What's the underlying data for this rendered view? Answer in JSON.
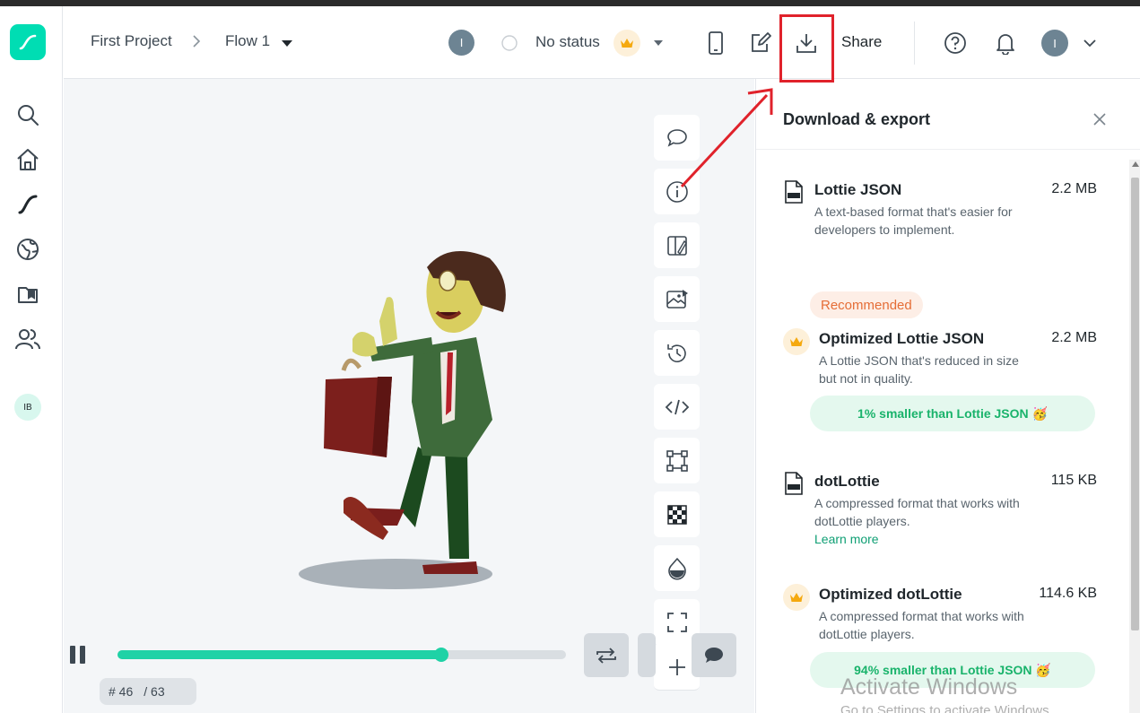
{
  "header": {
    "project": "First Project",
    "flow": "Flow 1",
    "user_initial": "I",
    "status": "No status",
    "share_label": "Share",
    "profile_initial": "I"
  },
  "sidebar": {
    "items": [
      {
        "icon": "search-icon"
      },
      {
        "icon": "home-icon"
      },
      {
        "icon": "lottie-logo-icon"
      },
      {
        "icon": "globe-icon"
      },
      {
        "icon": "library-icon"
      },
      {
        "icon": "team-icon"
      }
    ],
    "workspace_initials": "IB"
  },
  "canvas": {
    "tools": [
      "comment-icon",
      "info-icon",
      "theme-icon",
      "image-icon",
      "history-icon",
      "code-icon",
      "bounding-box-icon",
      "transparency-icon",
      "color-drop-icon",
      "fullscreen-icon",
      "zoom-in-icon"
    ],
    "playback": {
      "progress": 0.722,
      "frame_label": "# 46",
      "total_label": "/ 63"
    }
  },
  "panel": {
    "title": "Download & export",
    "recommended_label": "Recommended",
    "options": [
      {
        "title": "Lottie JSON",
        "size": "2.2 MB",
        "desc": "A text-based format that's easier for developers to implement."
      },
      {
        "title": "Optimized Lottie JSON",
        "size": "2.2 MB",
        "desc": "A Lottie JSON that's reduced in size but not in quality.",
        "savings": "1% smaller than Lottie JSON 🥳"
      },
      {
        "title": "dotLottie",
        "size": "115 KB",
        "desc": "A compressed format that works with dotLottie players.",
        "link": "Learn more"
      },
      {
        "title": "Optimized dotLottie",
        "size": "114.6 KB",
        "desc": "A compressed format that works with dotLottie players.",
        "savings": "94% smaller than Lottie JSON 🥳"
      }
    ]
  },
  "watermark": {
    "line1": "Activate Windows",
    "line2": "Go to Settings to activate Windows."
  },
  "colors": {
    "brand": "#00ddb3",
    "progress": "#1fd2a6",
    "highlight": "#e0222b",
    "recommended": "#e56d36",
    "savings_text": "#19b36b"
  }
}
